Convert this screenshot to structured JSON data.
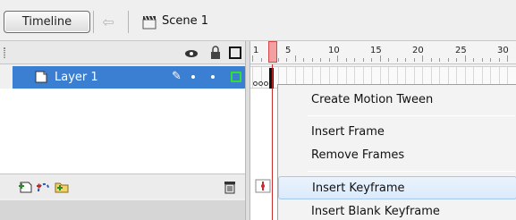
{
  "toolbar": {
    "timeline_label": "Timeline",
    "scene_label": "Scene 1",
    "back_icon": "left-arrow-icon",
    "scene_icon": "clapperboard-icon"
  },
  "layer_header": {
    "icons": [
      "eye-icon",
      "lock-icon",
      "outline-icon"
    ]
  },
  "layers": [
    {
      "name": "Layer 1",
      "selected": true,
      "icon": "layer-icon",
      "edit_icon": "pencil-icon",
      "outline_color": "#33dd33"
    }
  ],
  "footer_icons": [
    "new-layer-icon",
    "motion-guide-icon",
    "new-folder-icon",
    "trash-icon"
  ],
  "ruler": {
    "labels": [
      "1",
      "5",
      "10",
      "15",
      "20",
      "25",
      "30"
    ]
  },
  "menu": {
    "items": [
      "Create Motion Tween",
      "Insert Frame",
      "Remove Frames",
      "Insert Keyframe",
      "Insert Blank Keyframe"
    ],
    "highlighted": "Insert Keyframe"
  },
  "colors": {
    "selection": "#3a7fd2",
    "playhead": "#cc2b2b",
    "highlight": "#dbeafb"
  }
}
